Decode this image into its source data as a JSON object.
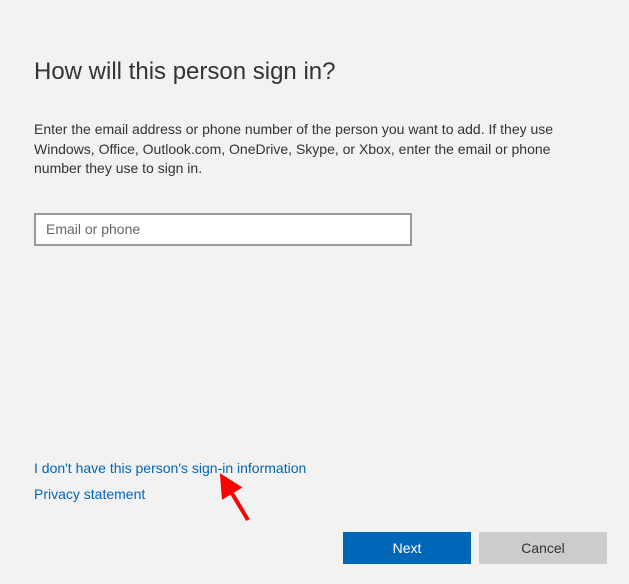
{
  "title": "How will this person sign in?",
  "description": "Enter the email address or phone number of the person you want to add. If they use Windows, Office, Outlook.com, OneDrive, Skype, or Xbox, enter the email or phone number they use to sign in.",
  "input": {
    "placeholder": "Email or phone",
    "value": ""
  },
  "links": {
    "no_info": "I don't have this person's sign-in information",
    "privacy": "Privacy statement"
  },
  "buttons": {
    "next": "Next",
    "cancel": "Cancel"
  }
}
